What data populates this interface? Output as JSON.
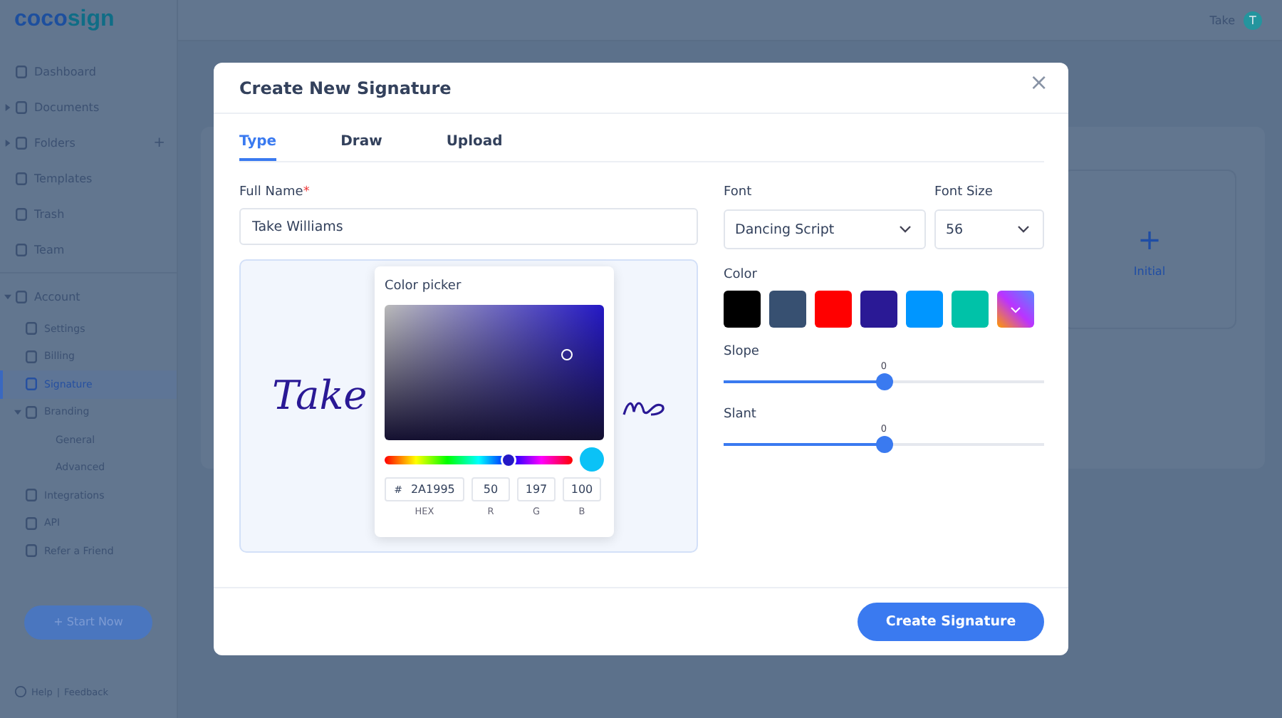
{
  "logo": {
    "part_1": "coco",
    "part_2": "sign"
  },
  "topbar": {
    "user": "Take",
    "avatar": "T"
  },
  "sidebar": {
    "items": [
      {
        "label": "Dashboard",
        "selected": false
      },
      {
        "label": "Documents",
        "expanded": false,
        "selected": false
      },
      {
        "label": "Folders",
        "expanded": false,
        "add": "+",
        "selected": false
      },
      {
        "label": "Templates",
        "selected": false
      },
      {
        "label": "Trash",
        "selected": false
      },
      {
        "label": "Team",
        "selected": false
      },
      {
        "label": "Account",
        "expanded": true,
        "selected": false,
        "children": [
          {
            "label": "Settings",
            "selected": false
          },
          {
            "label": "Billing",
            "selected": false
          },
          {
            "label": "Signature",
            "selected": true
          },
          {
            "label": "Branding",
            "expanded": true,
            "selected": false,
            "children": [
              {
                "label": "General",
                "selected": false
              },
              {
                "label": "Advanced",
                "selected": false
              }
            ]
          },
          {
            "label": "Integrations",
            "selected": false
          },
          {
            "label": "API",
            "selected": false
          },
          {
            "label": "Refer a Friend",
            "selected": false
          }
        ]
      }
    ],
    "start_button": "Start Now",
    "help": "Help",
    "separator": "|",
    "feedback": "Feedback"
  },
  "main": {
    "initial_card": {
      "icon": "+",
      "label": "Initial"
    }
  },
  "modal": {
    "title": "Create New Signature",
    "close": "×",
    "tabs": [
      {
        "label": "Type",
        "selected": true
      },
      {
        "label": "Draw",
        "selected": false
      },
      {
        "label": "Upload",
        "selected": false
      }
    ],
    "full_name": {
      "label": "Full Name",
      "required": "*",
      "value": "Take Williams"
    },
    "preview": {
      "visible_text": "Take"
    },
    "color_picker": {
      "title": "Color picker",
      "hue": {
        "level": 0.66
      },
      "fields": [
        {
          "prefix": "#",
          "value": "2A1995",
          "label": "HEX"
        },
        {
          "value": "50",
          "label": "R"
        },
        {
          "value": "197",
          "label": "G"
        },
        {
          "value": "100",
          "label": "B"
        }
      ]
    },
    "font": {
      "label": "Font",
      "value": "Dancing Script"
    },
    "font_size": {
      "label": "Font Size",
      "value": "56"
    },
    "color": {
      "label": "Color",
      "swatches": [
        {
          "kind": "solid",
          "color": "#000000"
        },
        {
          "kind": "solid",
          "color": "#375071"
        },
        {
          "kind": "solid",
          "color": "#ff0000"
        },
        {
          "kind": "solid",
          "color": "#2a1995"
        },
        {
          "kind": "solid",
          "color": "#0096ff"
        },
        {
          "kind": "solid",
          "color": "#00c2a8"
        },
        {
          "kind": "custom"
        }
      ]
    },
    "sliders": [
      {
        "label": "Slope",
        "reading": "0",
        "level": 0.5
      },
      {
        "label": "Slant",
        "reading": "0",
        "level": 0.5
      }
    ],
    "submit": "Create Signature"
  }
}
